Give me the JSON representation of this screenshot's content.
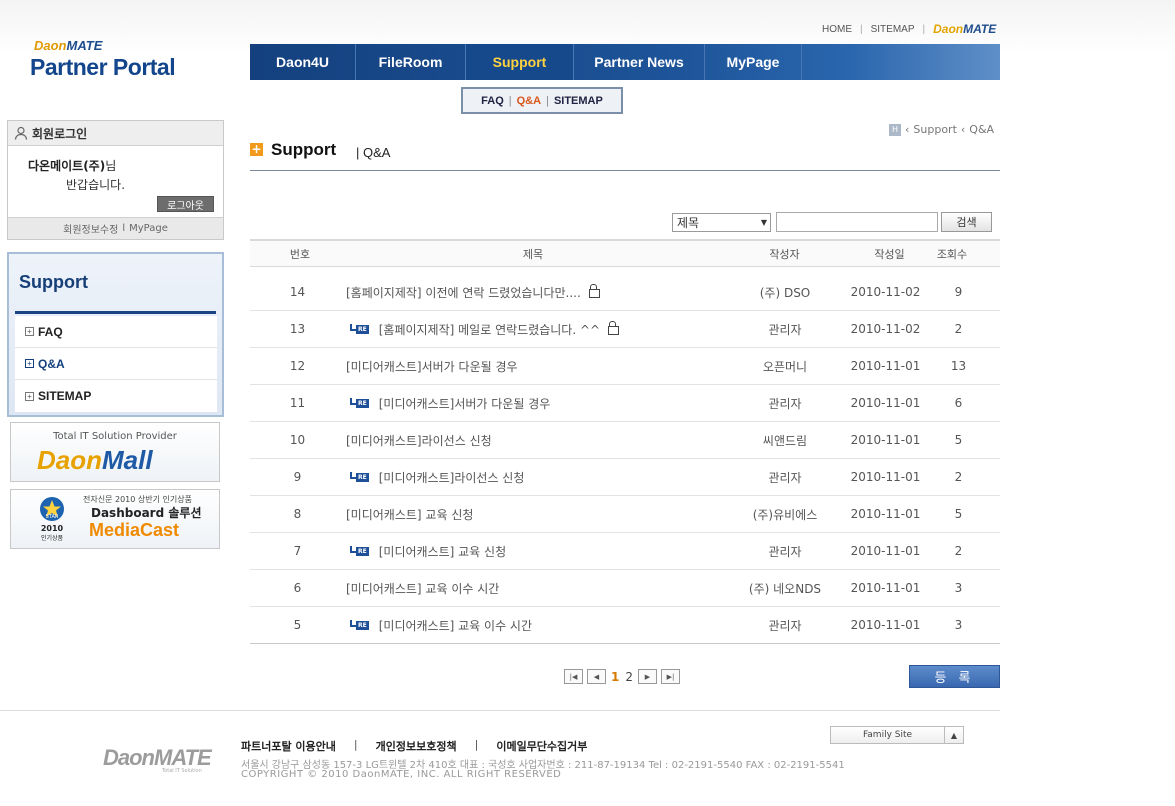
{
  "header": {
    "util_links": [
      "HOME",
      "SITEMAP"
    ],
    "util_logo_a": "Daon",
    "util_logo_b": "MATE",
    "logo_small_a": "Daon",
    "logo_small_b": "MATE",
    "logo_main": "Partner Portal"
  },
  "gnb": [
    {
      "label": "Daon4U",
      "active": false
    },
    {
      "label": "FileRoom",
      "active": false
    },
    {
      "label": "Support",
      "active": true
    },
    {
      "label": "Partner News",
      "active": false
    },
    {
      "label": "MyPage",
      "active": false
    }
  ],
  "subnav": {
    "faq": "FAQ",
    "qna": "Q&A",
    "sitemap": "SITEMAP"
  },
  "login": {
    "title": "회원로그인",
    "company": "다온메이트(주)",
    "suffix": "님",
    "greeting": "반갑습니다.",
    "logout": "로그아웃",
    "edit_info": "회원정보수정",
    "sep": "l",
    "mypage": "MyPage"
  },
  "lnb": {
    "title": "Support",
    "items": [
      {
        "label": "FAQ",
        "active": false
      },
      {
        "label": "Q&A",
        "active": true
      },
      {
        "label": "SITEMAP",
        "active": false
      }
    ]
  },
  "banners": {
    "b1_top": "Total IT Solution Provider",
    "b1_logo_a": "Daon",
    "b1_logo_b": "Mall",
    "b2_small": "전자신문 2010 상반기 인기상품",
    "b2_mid": "Dashboard 솔루션",
    "b2_big": "MediaCast",
    "b2_badge_top": "STAR",
    "b2_badge_year": "2010",
    "b2_badge_bottom": "인기상품"
  },
  "content": {
    "title": "Support",
    "subtitle": "| Q&A",
    "breadcrumb": [
      "Support",
      "Q&A"
    ],
    "breadcrumb_home": "H"
  },
  "search": {
    "select_value": "제목",
    "button": "검색"
  },
  "table": {
    "headers": [
      "번호",
      "제목",
      "작성자",
      "작성일",
      "조회수"
    ],
    "rows": [
      {
        "no": "14",
        "title": "[홈페이지제작] 이전에 연락 드렸었습니다만....",
        "reply": false,
        "lock": true,
        "writer": "(주) DSO",
        "date": "2010-11-02",
        "hits": "9"
      },
      {
        "no": "13",
        "title": "[홈페이지제작] 메일로 연락드렸습니다. ^^",
        "reply": true,
        "lock": true,
        "writer": "관리자",
        "date": "2010-11-02",
        "hits": "2"
      },
      {
        "no": "12",
        "title": "[미디어캐스트]서버가 다운될 경우",
        "reply": false,
        "lock": false,
        "writer": "오픈머니",
        "date": "2010-11-01",
        "hits": "13"
      },
      {
        "no": "11",
        "title": "[미디어캐스트]서버가 다운될 경우",
        "reply": true,
        "lock": false,
        "writer": "관리자",
        "date": "2010-11-01",
        "hits": "6"
      },
      {
        "no": "10",
        "title": "[미디어캐스트]라이선스 신청",
        "reply": false,
        "lock": false,
        "writer": "씨앤드림",
        "date": "2010-11-01",
        "hits": "5"
      },
      {
        "no": "9",
        "title": "[미디어캐스트]라이선스 신청",
        "reply": true,
        "lock": false,
        "writer": "관리자",
        "date": "2010-11-01",
        "hits": "2"
      },
      {
        "no": "8",
        "title": "[미디어캐스트] 교육 신청",
        "reply": false,
        "lock": false,
        "writer": "(주)유비에스",
        "date": "2010-11-01",
        "hits": "5"
      },
      {
        "no": "7",
        "title": "[미디어캐스트] 교육 신청",
        "reply": true,
        "lock": false,
        "writer": "관리자",
        "date": "2010-11-01",
        "hits": "2"
      },
      {
        "no": "6",
        "title": "[미디어캐스트] 교육 이수 시간",
        "reply": false,
        "lock": false,
        "writer": "(주) 네오NDS",
        "date": "2010-11-01",
        "hits": "3"
      },
      {
        "no": "5",
        "title": "[미디어캐스트] 교육 이수 시간",
        "reply": true,
        "lock": false,
        "writer": "관리자",
        "date": "2010-11-01",
        "hits": "3"
      }
    ],
    "reply_tag": "RE"
  },
  "pagination": {
    "pages": [
      "1",
      "2"
    ],
    "current": "1"
  },
  "register_button": "등 록",
  "footer": {
    "links": [
      "파트너포탈 이용안내",
      "개인정보보호정책",
      "이메일무단수집거부"
    ],
    "address": "서울시 강남구 삼성동 157-3 LG트윈텔 2차 410호   대표 : 국성호 사업자번호 : 211-87-19134    Tel : 02-2191-5540    FAX : 02-2191-5541",
    "copyright": "COPYRIGHT © 2010 DaonMATE, INC. ALL RIGHT RESERVED",
    "logo": "DaonMATE",
    "logo_sub": "Total IT Solution",
    "family_site": "Family Site"
  },
  "colors": {
    "gnb": "#1d5398",
    "accent": "#d9561c",
    "active_menu": "#ffd23f"
  }
}
